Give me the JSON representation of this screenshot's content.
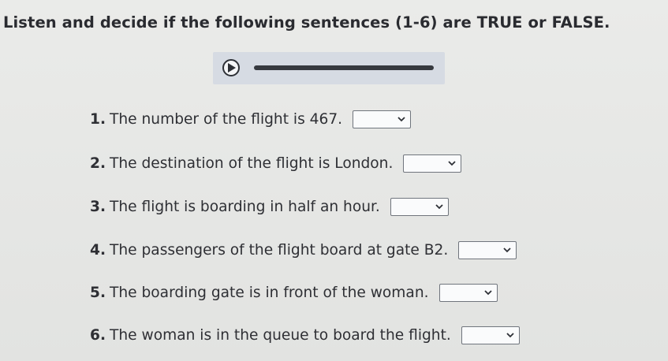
{
  "instruction": "Listen and decide if the following sentences (1-6) are TRUE or FALSE.",
  "audio": {
    "play_icon": "play-icon",
    "progress": 0
  },
  "questions": [
    {
      "number": "1.",
      "text": "The number of the flight is 467.",
      "selected": ""
    },
    {
      "number": "2.",
      "text": "The destination of the flight is London.",
      "selected": ""
    },
    {
      "number": "3.",
      "text": "The flight is boarding in half an hour.",
      "selected": ""
    },
    {
      "number": "4.",
      "text": "The passengers of the flight board at gate B2.",
      "selected": ""
    },
    {
      "number": "5.",
      "text": "The boarding gate is in front of the woman.",
      "selected": ""
    },
    {
      "number": "6.",
      "text": "The woman is in the queue to board the flight.",
      "selected": ""
    }
  ],
  "dropdown_icon": "chevron-down-icon"
}
